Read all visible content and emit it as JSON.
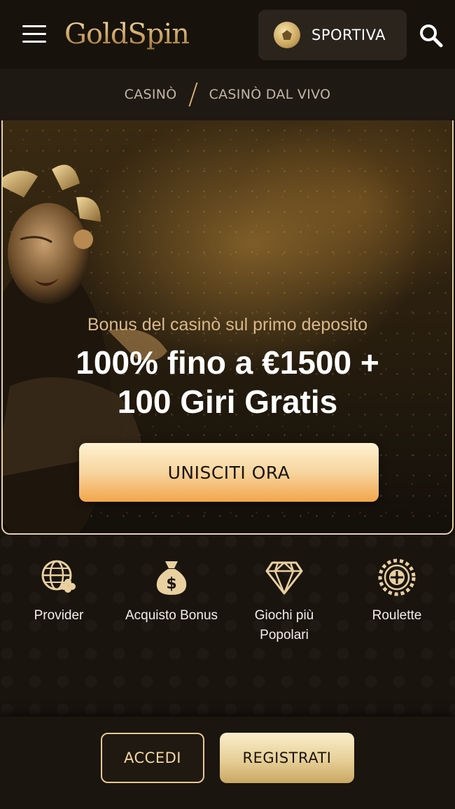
{
  "header": {
    "logo_text": "GoldSpin",
    "sport_label": "SPORTIVA",
    "icons": [
      "menu-icon",
      "football-icon",
      "search-icon"
    ]
  },
  "breadcrumb": {
    "items": [
      "CASINÒ",
      "CASINÒ DAL VIVO"
    ]
  },
  "hero": {
    "subtitle": "Bonus del casinò sul primo deposito",
    "title_line1": "100% fino a €1500 +",
    "title_line2": "100 Giri Gratis",
    "cta_label": "UNISCITI ORA"
  },
  "categories": [
    {
      "label": "Provider",
      "icon": "globe-clover-icon"
    },
    {
      "label": "Acquisto Bonus",
      "icon": "money-bag-icon"
    },
    {
      "label": "Giochi più Popolari",
      "icon": "diamond-icon"
    },
    {
      "label": "Roulette",
      "icon": "roulette-icon"
    }
  ],
  "bottom_bar": {
    "login_label": "ACCEDI",
    "register_label": "REGISTRATI"
  },
  "colors": {
    "gold": "#e8c88e",
    "background": "#1a140e",
    "cta_top": "#fff2d2",
    "cta_bottom": "#f2a64a"
  }
}
